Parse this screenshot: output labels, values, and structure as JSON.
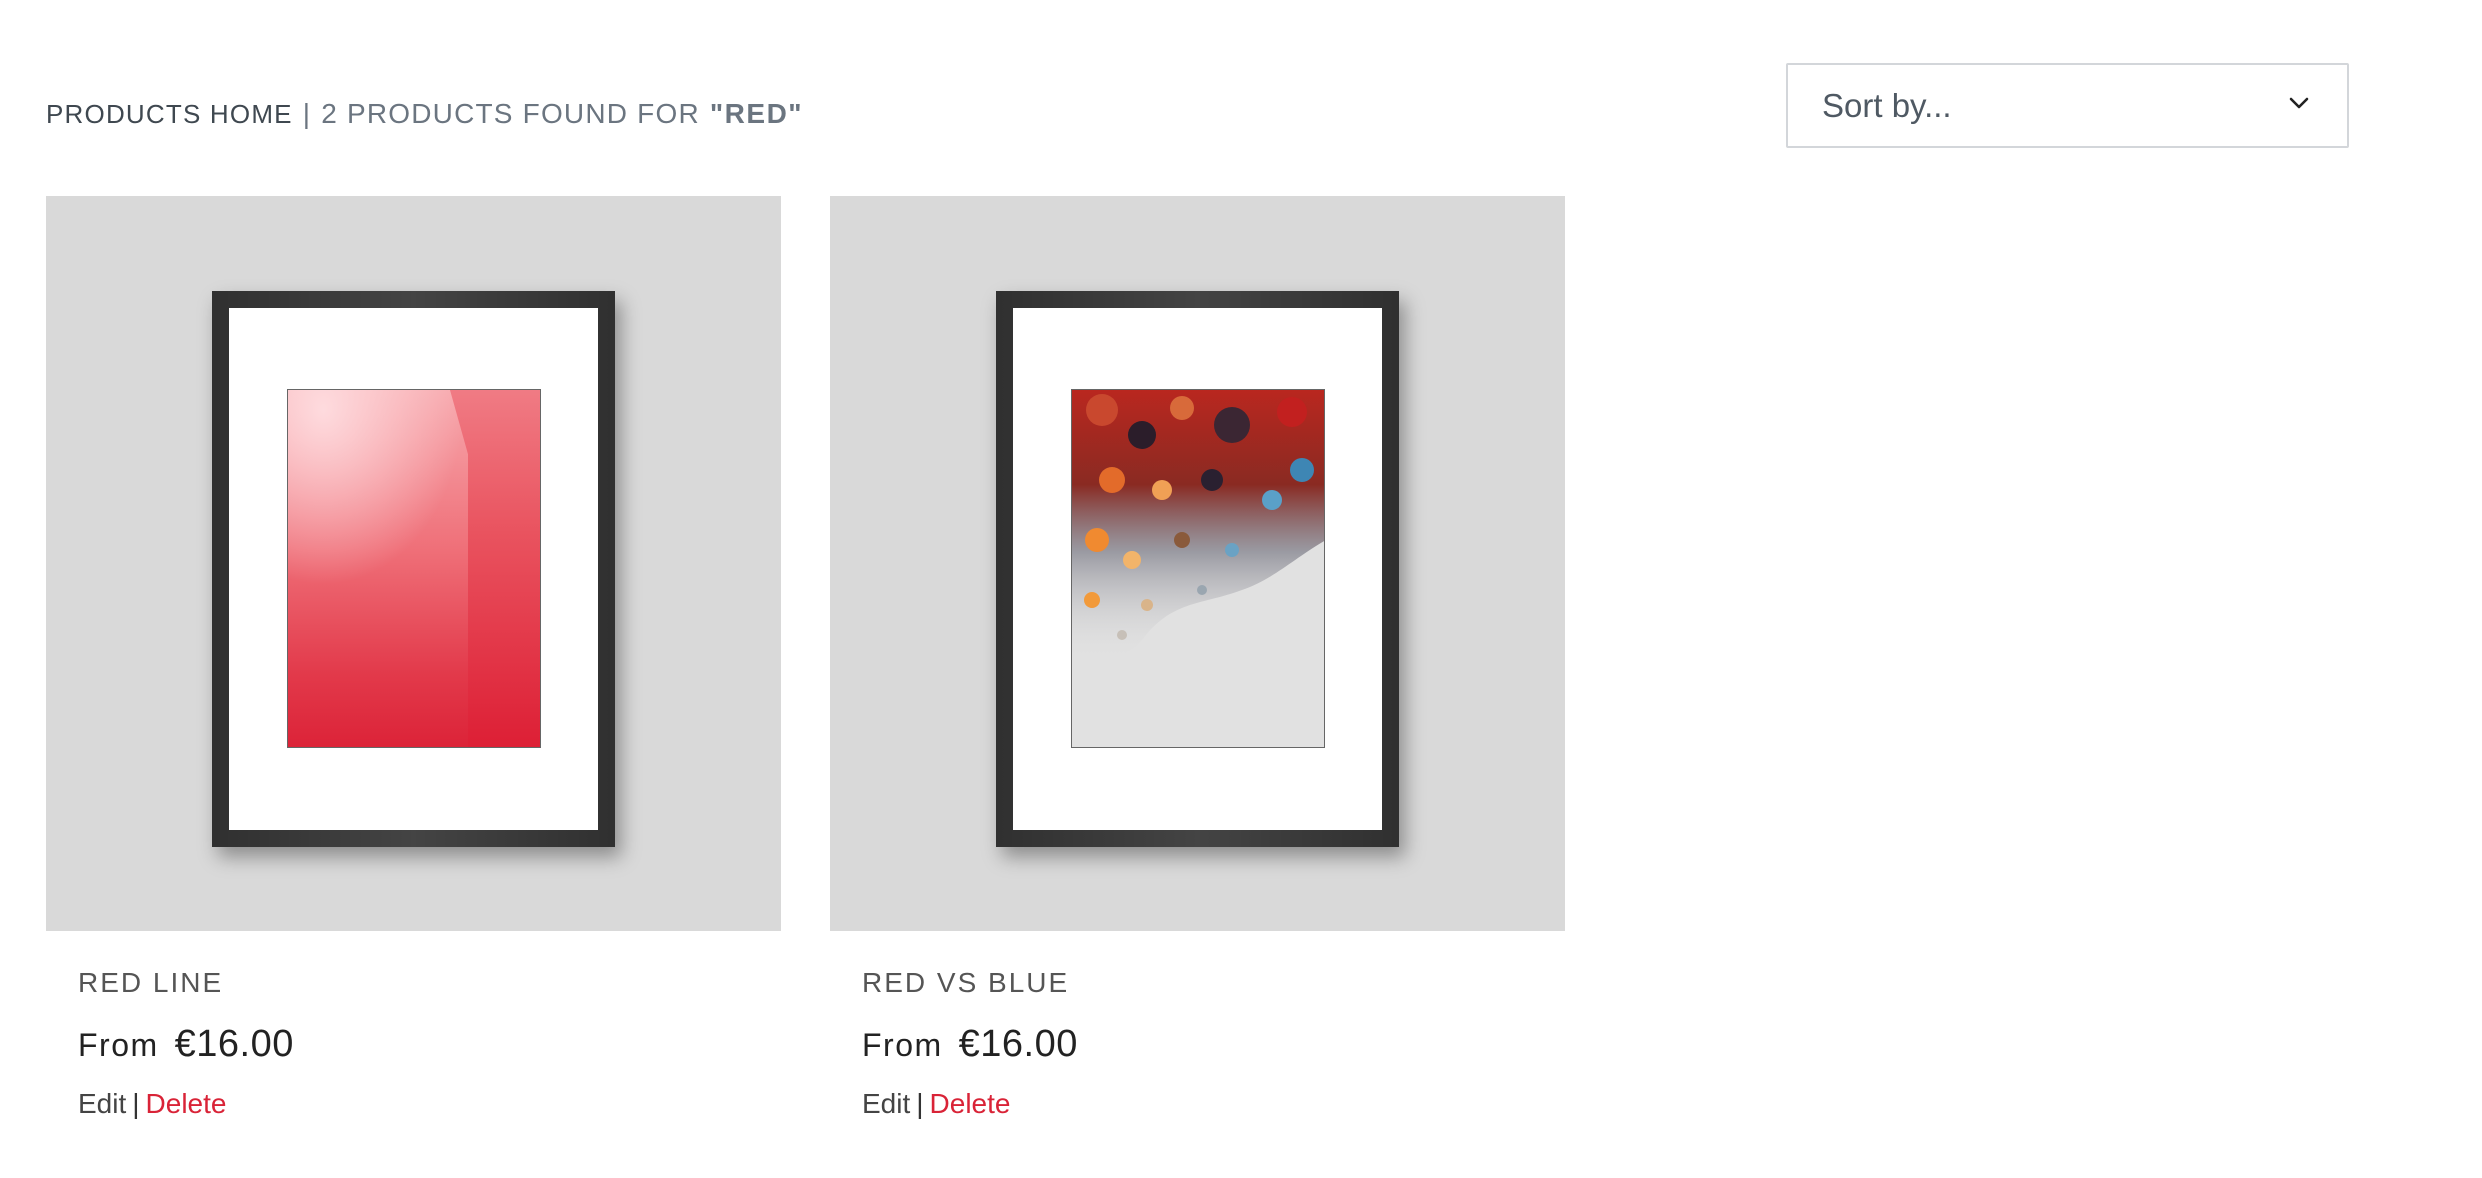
{
  "header": {
    "breadcrumb_home": "Products Home",
    "separator": "|",
    "result_text": "2 Products found for",
    "query": "\"red\""
  },
  "sort": {
    "label": "Sort by..."
  },
  "products": [
    {
      "title": "Red Line",
      "price_prefix": "From",
      "price": "€16.00",
      "edit_label": "Edit",
      "separator": "|",
      "delete_label": "Delete"
    },
    {
      "title": "Red vs Blue",
      "price_prefix": "From",
      "price": "€16.00",
      "edit_label": "Edit",
      "separator": "|",
      "delete_label": "Delete"
    }
  ],
  "colors": {
    "delete": "#d92337",
    "image_background": "#d9d9d9",
    "frame": "#232323"
  }
}
